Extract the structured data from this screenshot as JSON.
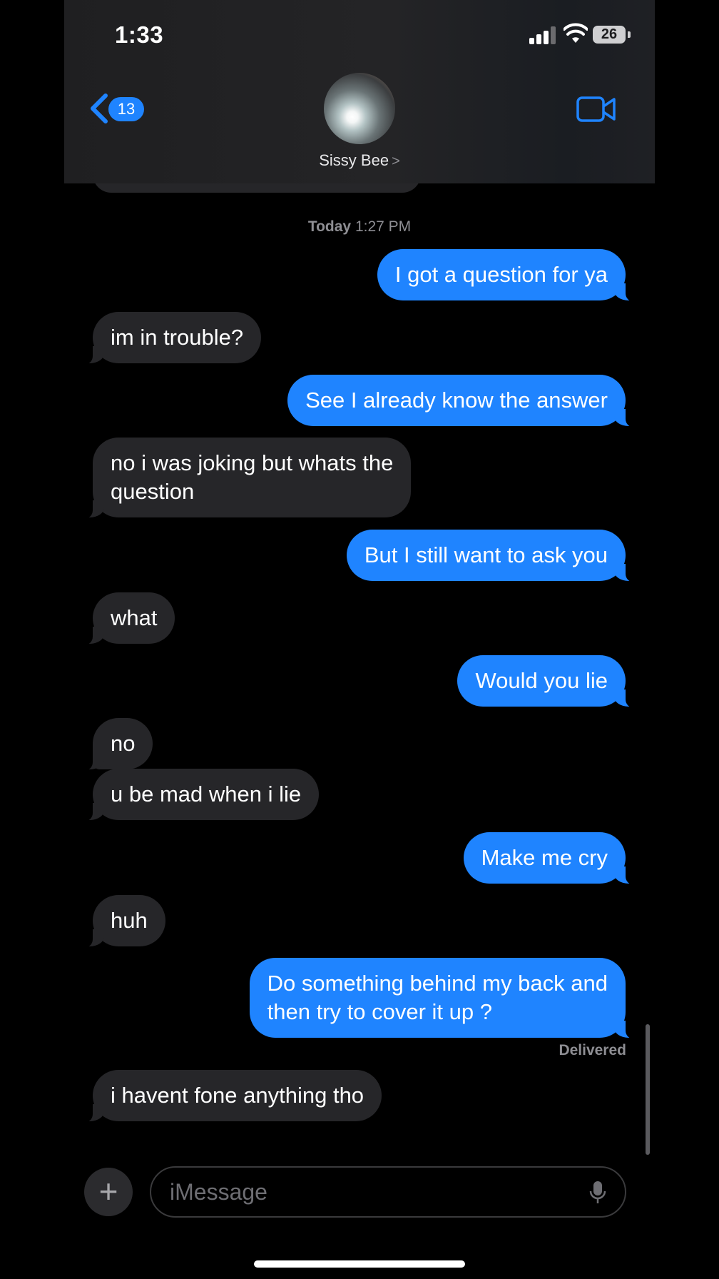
{
  "status_bar": {
    "time": "1:33",
    "battery": "26"
  },
  "header": {
    "back_badge": "13",
    "contact_name": "Sissy Bee",
    "contact_chevron": ">"
  },
  "timestamp": {
    "day": "Today",
    "time": "1:27 PM"
  },
  "messages": [
    {
      "from": "me",
      "text": "I got a question for ya"
    },
    {
      "from": "them",
      "text": "im in trouble?"
    },
    {
      "from": "me",
      "text": "See I already know the answer"
    },
    {
      "from": "them",
      "text": "no i was joking but whats the\nquestion"
    },
    {
      "from": "me",
      "text": "But I still want to ask you"
    },
    {
      "from": "them",
      "text": "what"
    },
    {
      "from": "me",
      "text": "Would you lie"
    },
    {
      "from": "them",
      "text": "no"
    },
    {
      "from": "them",
      "text": "u be mad when i lie"
    },
    {
      "from": "me",
      "text": "Make me cry"
    },
    {
      "from": "them",
      "text": "huh"
    },
    {
      "from": "me",
      "text": "Do something behind my back and\nthen try to cover it up ?"
    },
    {
      "from": "them",
      "text": "i havent fone anything tho"
    }
  ],
  "delivered_label": "Delivered",
  "composer": {
    "plus": "+",
    "placeholder": "iMessage"
  },
  "colors": {
    "outgoing": "#1f84ff",
    "incoming": "#262629",
    "accent": "#1f84ff"
  },
  "icons": [
    "signal-icon",
    "wifi-icon",
    "battery-icon",
    "back-chevron-icon",
    "video-call-icon",
    "add-icon",
    "microphone-icon"
  ]
}
